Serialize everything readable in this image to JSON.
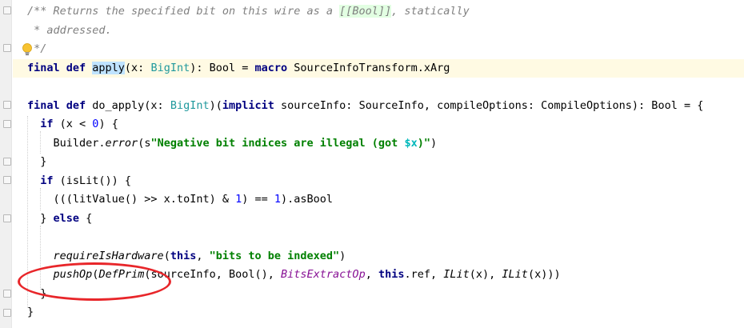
{
  "editor": {
    "language": "scala",
    "lines": [
      {
        "tokens": [
          {
            "t": "/** Returns the specified bit on this wire as a ",
            "c": "doc"
          },
          {
            "t": "[[Bool]]",
            "c": "doclink"
          },
          {
            "t": ", statically",
            "c": "doc"
          }
        ]
      },
      {
        "tokens": [
          {
            "t": " * addressed.",
            "c": "doc"
          }
        ]
      },
      {
        "tokens": [
          {
            "t": " */",
            "c": "doc"
          }
        ]
      },
      {
        "current": true,
        "tokens": [
          {
            "t": "final def ",
            "c": "kw"
          },
          {
            "t": "",
            "c": "caret"
          },
          {
            "t": "apply",
            "c": "paren-hl"
          },
          {
            "t": "(x: "
          },
          {
            "t": "BigInt",
            "c": "type"
          },
          {
            "t": "): Bool = "
          },
          {
            "t": "macro",
            "c": "kw"
          },
          {
            "t": " SourceInfoTransform.xArg"
          }
        ]
      },
      {
        "tokens": []
      },
      {
        "tokens": [
          {
            "t": "final def ",
            "c": "kw"
          },
          {
            "t": "do_apply(x: "
          },
          {
            "t": "BigInt",
            "c": "type"
          },
          {
            "t": ")("
          },
          {
            "t": "implicit",
            "c": "kw"
          },
          {
            "t": " sourceInfo: SourceInfo, compileOptions: CompileOptions): Bool = {"
          }
        ]
      },
      {
        "tokens": [
          {
            "t": "  if",
            "c": "kw"
          },
          {
            "t": " (x < "
          },
          {
            "t": "0",
            "c": "num"
          },
          {
            "t": ") {"
          }
        ]
      },
      {
        "tokens": [
          {
            "t": "    Builder."
          },
          {
            "t": "error",
            "c": "italic"
          },
          {
            "t": "(s",
            "c": ""
          },
          {
            "t": "\"Negative bit indices are illegal (got ",
            "c": "str"
          },
          {
            "t": "$x",
            "c": "interp"
          },
          {
            "t": ")\"",
            "c": "str"
          },
          {
            "t": ")"
          }
        ]
      },
      {
        "tokens": [
          {
            "t": "  }"
          }
        ]
      },
      {
        "tokens": [
          {
            "t": "  if",
            "c": "kw"
          },
          {
            "t": " (isLit()) {"
          }
        ]
      },
      {
        "tokens": [
          {
            "t": "    (((litValue() >> x.toInt) & "
          },
          {
            "t": "1",
            "c": "num"
          },
          {
            "t": ") == "
          },
          {
            "t": "1",
            "c": "num"
          },
          {
            "t": ").asBool"
          }
        ]
      },
      {
        "tokens": [
          {
            "t": "  } "
          },
          {
            "t": "else",
            "c": "kw"
          },
          {
            "t": " {"
          }
        ]
      },
      {
        "tokens": []
      },
      {
        "tokens": [
          {
            "t": "    "
          },
          {
            "t": "requireIsHardware",
            "c": "italic"
          },
          {
            "t": "("
          },
          {
            "t": "this",
            "c": "kw"
          },
          {
            "t": ", "
          },
          {
            "t": "\"bits to be indexed\"",
            "c": "str"
          },
          {
            "t": ")"
          }
        ]
      },
      {
        "tokens": [
          {
            "t": "    "
          },
          {
            "t": "pushOp",
            "c": "italic"
          },
          {
            "t": "("
          },
          {
            "t": "DefPrim",
            "c": "italic"
          },
          {
            "t": "(sourceInfo, Bool(), "
          },
          {
            "t": "BitsExtractOp",
            "c": "purple"
          },
          {
            "t": ", "
          },
          {
            "t": "this",
            "c": "kw"
          },
          {
            "t": ".ref, "
          },
          {
            "t": "ILit",
            "c": "italic"
          },
          {
            "t": "(x), "
          },
          {
            "t": "ILit",
            "c": "italic"
          },
          {
            "t": "(x)))"
          }
        ]
      },
      {
        "tokens": [
          {
            "t": "  }"
          }
        ]
      },
      {
        "tokens": [
          {
            "t": "}"
          }
        ]
      }
    ]
  },
  "icons": {
    "intention": "lightbulb-icon"
  },
  "colors": {
    "annotation": "#e8262a",
    "current_line": "#fffae3"
  }
}
